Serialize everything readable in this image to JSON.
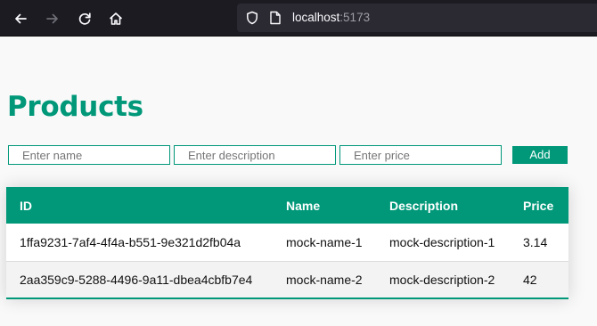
{
  "browser": {
    "url_host": "localhost",
    "url_port": ":5173",
    "icons": {
      "back": "back-arrow-icon",
      "forward": "forward-arrow-icon",
      "reload": "reload-icon",
      "home": "home-icon",
      "shield": "shield-icon",
      "page": "page-icon"
    }
  },
  "page": {
    "title": "Products",
    "form": {
      "name_placeholder": "Enter name",
      "description_placeholder": "Enter description",
      "price_placeholder": "Enter price",
      "name_value": "",
      "description_value": "",
      "price_value": "",
      "add_label": "Add"
    },
    "table": {
      "headers": [
        "ID",
        "Name",
        "Description",
        "Price"
      ],
      "rows": [
        [
          "1ffa9231-7af4-4f4a-b551-9e321d2fb04a",
          "mock-name-1",
          "mock-description-1",
          "3.14"
        ],
        [
          "2aa359c9-5288-4496-9a11-dbea4cbfb7e4",
          "mock-name-2",
          "mock-description-2",
          "42"
        ]
      ]
    }
  },
  "colors": {
    "accent": "#009879",
    "toolbar_bg": "#1c1b22",
    "urlbar_bg": "#2b2a33",
    "page_bg": "#f9f9f9"
  }
}
